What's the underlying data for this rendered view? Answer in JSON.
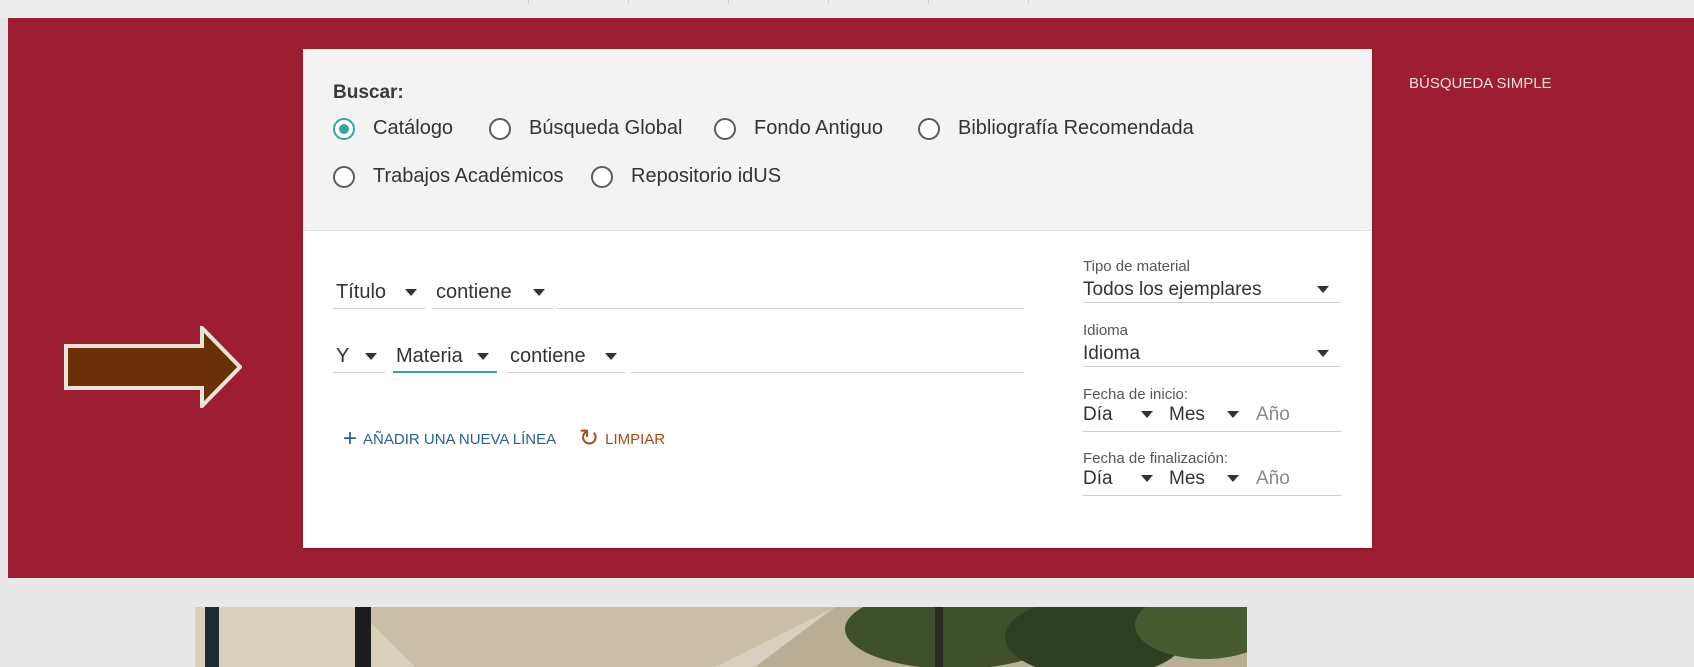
{
  "scope": {
    "label": "Buscar:",
    "options": [
      {
        "label": "Catálogo",
        "checked": true
      },
      {
        "label": "Búsqueda Global",
        "checked": false
      },
      {
        "label": "Fondo Antiguo",
        "checked": false
      },
      {
        "label": "Bibliografía Recomendada",
        "checked": false
      },
      {
        "label": "Trabajos Académicos",
        "checked": false
      },
      {
        "label": "Repositorio idUS",
        "checked": false
      }
    ]
  },
  "query": {
    "line1": {
      "field": "Título",
      "operator": "contiene",
      "value": ""
    },
    "line2": {
      "boolean": "Y",
      "field": "Materia",
      "operator": "contiene",
      "value": ""
    }
  },
  "actions": {
    "add_line": "AÑADIR UNA NUEVA LÍNEA",
    "clear": "LIMPIAR"
  },
  "filters": {
    "material": {
      "label": "Tipo de material",
      "value": "Todos los ejemplares"
    },
    "language": {
      "label": "Idioma",
      "value": "Idioma"
    },
    "start_date": {
      "label": "Fecha de inicio:",
      "day": "Día",
      "month": "Mes",
      "year_placeholder": "Año"
    },
    "end_date": {
      "label": "Fecha de finalización:",
      "day": "Día",
      "month": "Mes",
      "year_placeholder": "Año"
    }
  },
  "simple_search_link": "BÚSQUEDA SIMPLE",
  "colors": {
    "crimson": "#9d1e31",
    "accent": "#3aa3a3",
    "arrow_fill": "#6b3008",
    "link_blue": "#2a5f8e",
    "link_orange": "#a64a12"
  },
  "icons": {
    "add": "plus-icon",
    "clear": "refresh-icon",
    "pointer": "arrow-right-icon"
  }
}
